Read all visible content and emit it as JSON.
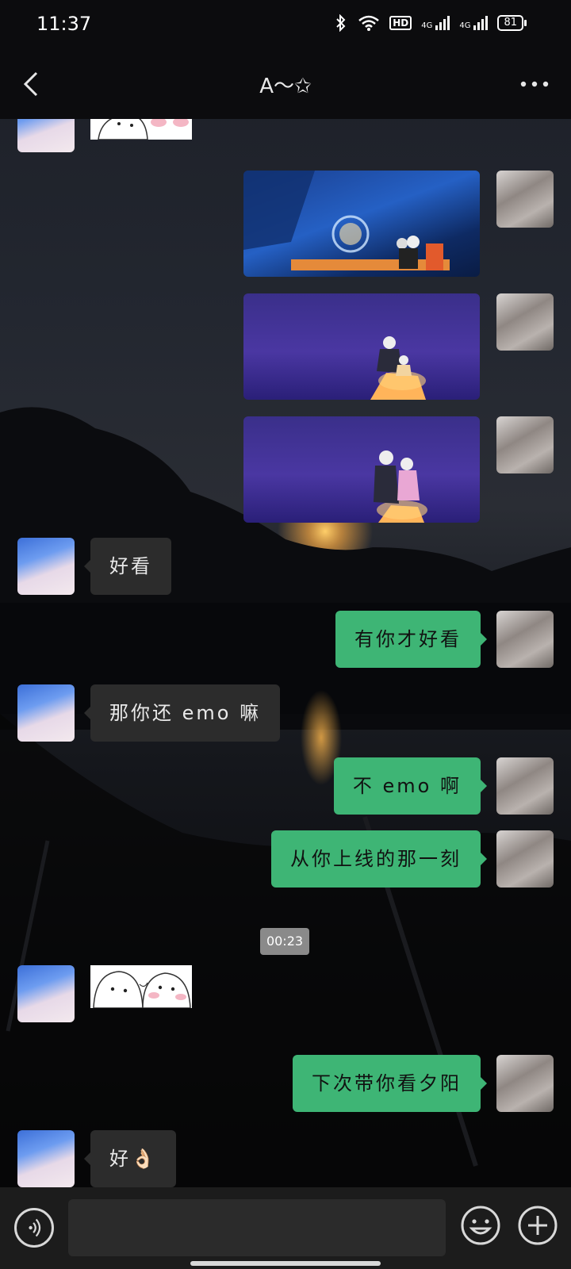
{
  "status_bar": {
    "time": "11:37",
    "hd_label": "HD",
    "net1": "4G",
    "net2": "4G",
    "battery": "81"
  },
  "header": {
    "title": "A～✩",
    "back_icon": "back-chevron-icon",
    "more_icon": "more-dots-icon"
  },
  "messages": [
    {
      "side": "left",
      "type": "sticker"
    },
    {
      "side": "right",
      "type": "image"
    },
    {
      "side": "right",
      "type": "image"
    },
    {
      "side": "right",
      "type": "image"
    },
    {
      "side": "left",
      "type": "text",
      "text": "好看"
    },
    {
      "side": "right",
      "type": "text",
      "text": "有你才好看"
    },
    {
      "side": "left",
      "type": "text",
      "text": "那你还 emo 嘛"
    },
    {
      "side": "right",
      "type": "text",
      "text": "不 emo 啊"
    },
    {
      "side": "right",
      "type": "text",
      "text": "从你上线的那一刻"
    },
    {
      "side": "center",
      "type": "time",
      "text": "00:23"
    },
    {
      "side": "left",
      "type": "sticker"
    },
    {
      "side": "right",
      "type": "text",
      "text": "下次带你看夕阳"
    },
    {
      "side": "left",
      "type": "text",
      "text": "好👌🏻"
    }
  ],
  "input_bar": {
    "voice_icon": "voice-input-icon",
    "emoji_icon": "emoji-icon",
    "plus_icon": "plus-icon",
    "placeholder": ""
  },
  "colors": {
    "bubble_right": "#3eb575",
    "bubble_left": "#2c2c2c",
    "bar_bg": "#0c0c0e"
  }
}
